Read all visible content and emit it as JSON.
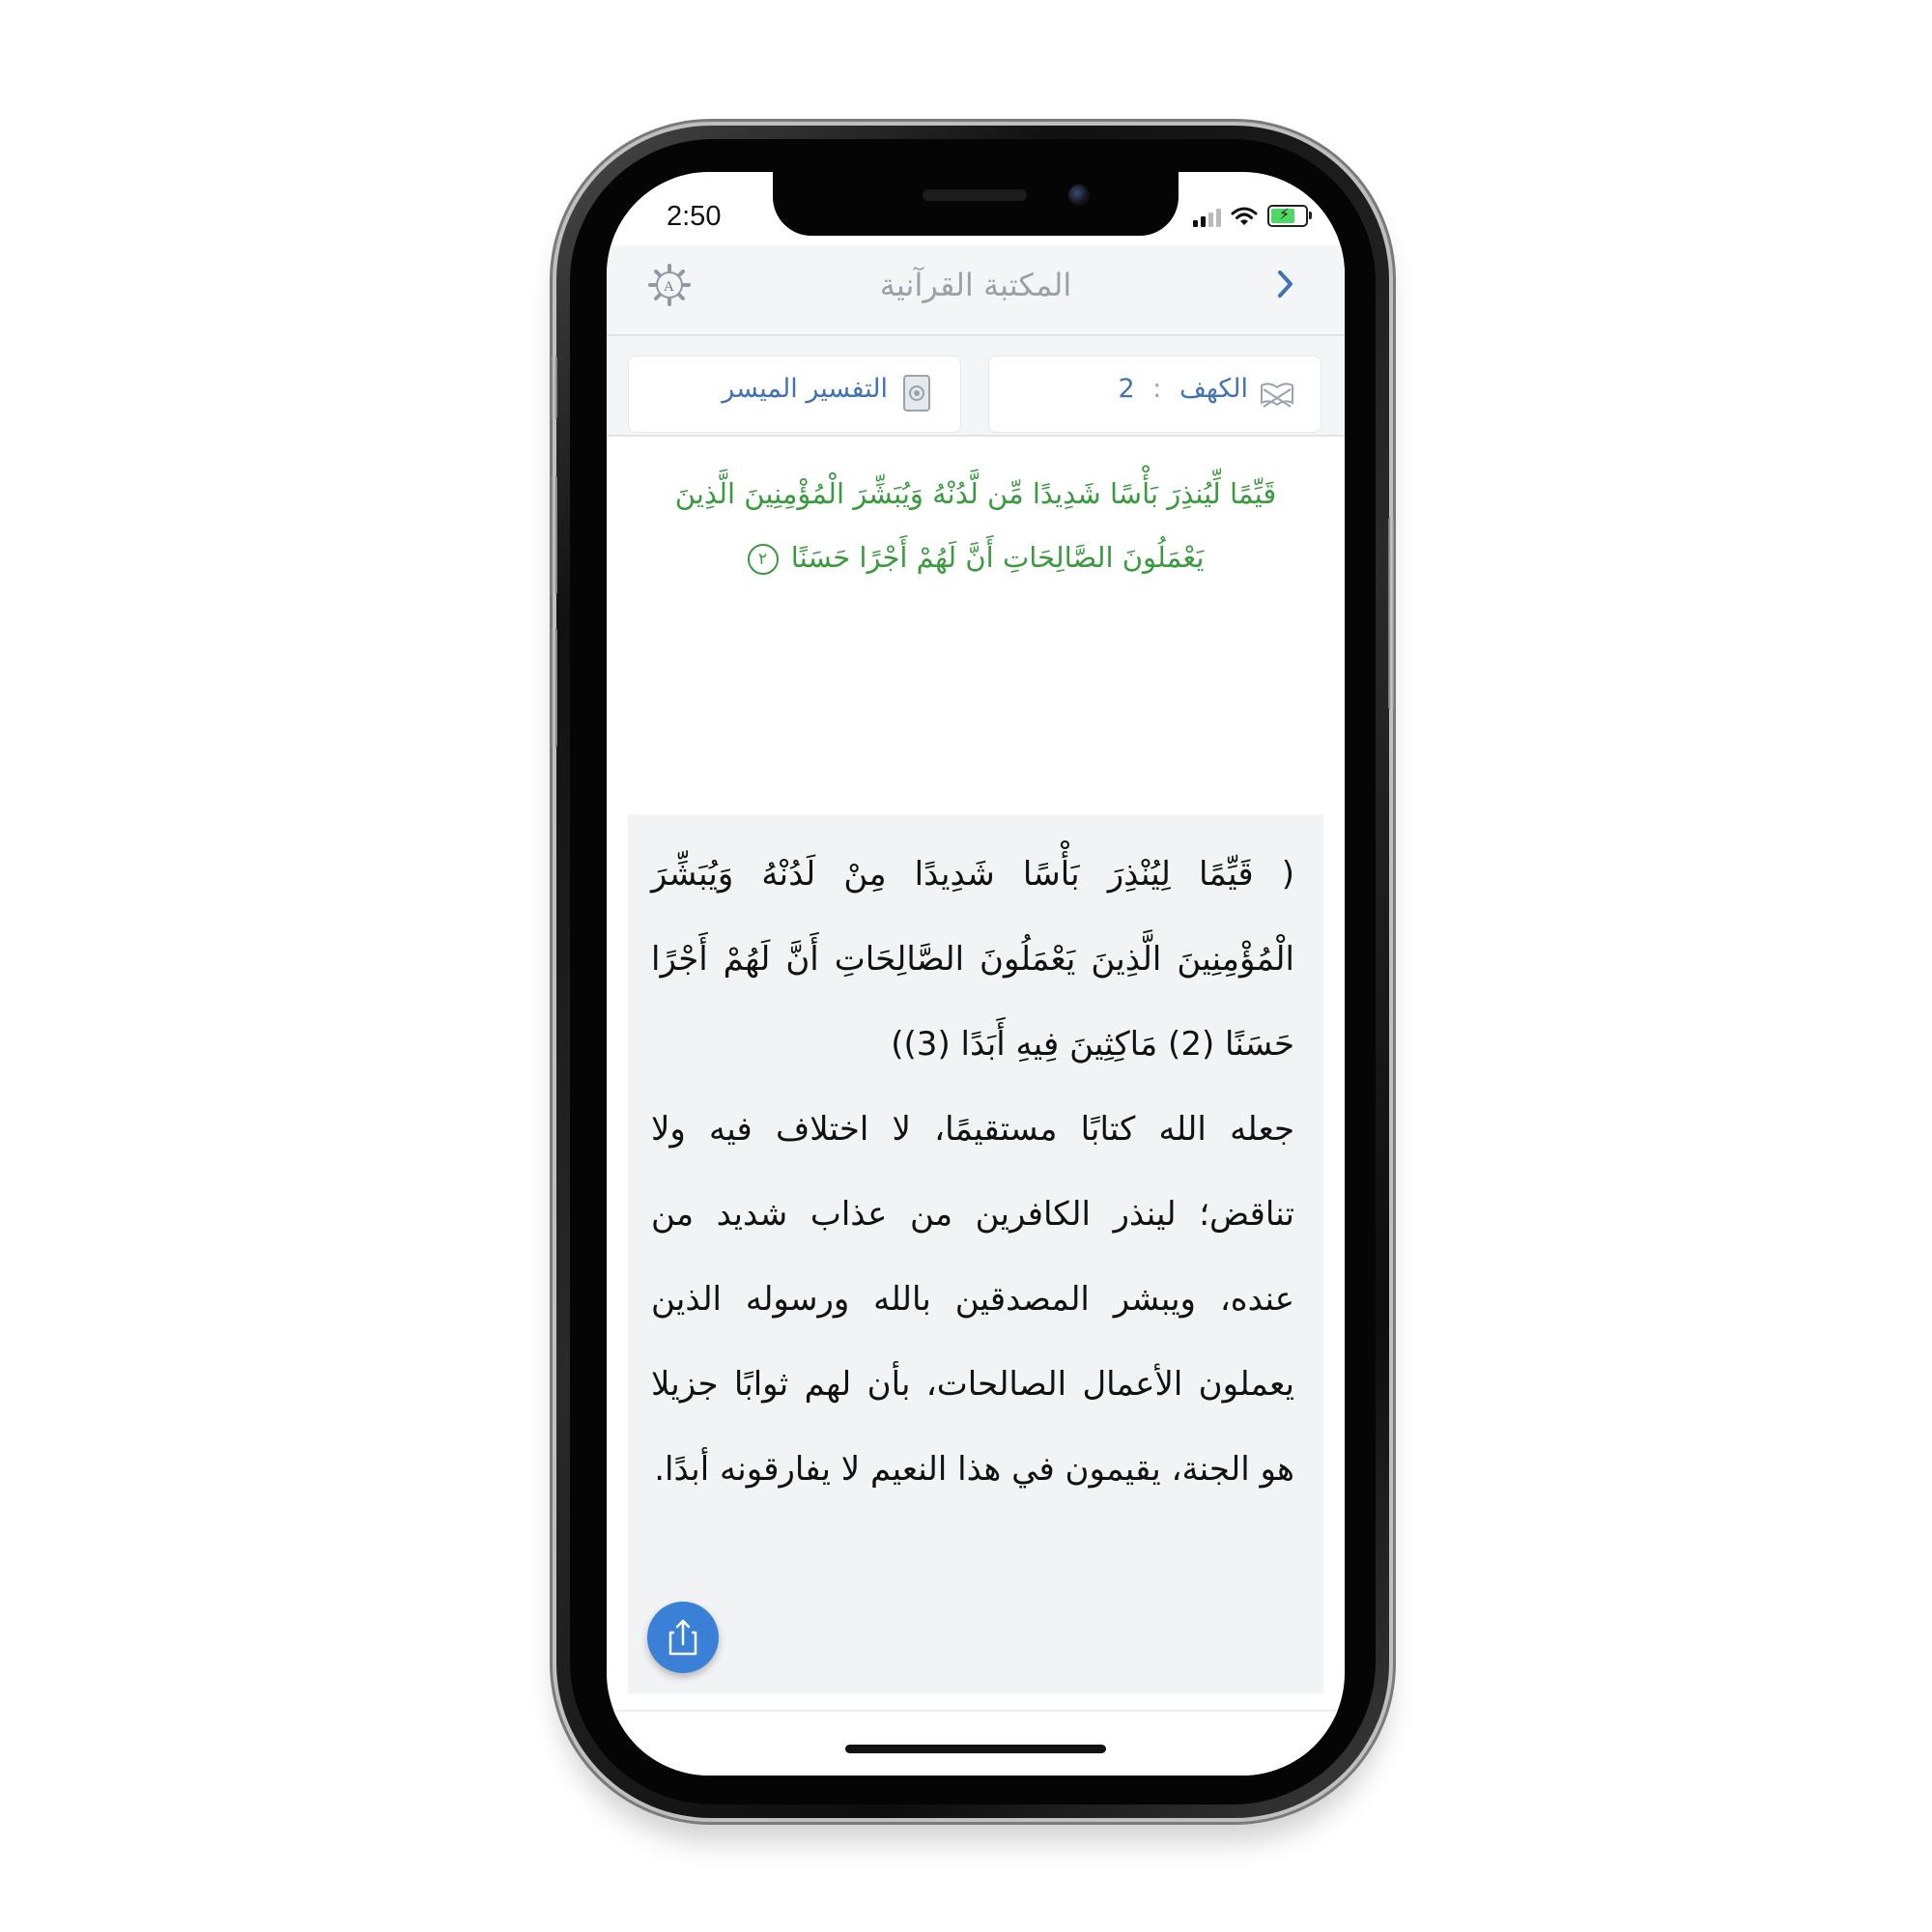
{
  "status_bar": {
    "time": "2:50"
  },
  "navbar": {
    "title": "المكتبة القرآنية"
  },
  "selectors": {
    "surah": {
      "name": "الكهف",
      "separator": ":",
      "ayah": "2"
    },
    "tafsir": {
      "label": "التفسير الميسر"
    }
  },
  "verse": {
    "text": "قَيِّمًا لِّيُنذِرَ بَأْسًا شَدِيدًا مِّن لَّدُنْهُ وَيُبَشِّرَ الْمُؤْمِنِينَ الَّذِينَ يَعْمَلُونَ الصَّالِحَاتِ أَنَّ لَهُمْ أَجْرًا حَسَنًا",
    "number": "٢"
  },
  "tafsir": {
    "quote": "( قَيِّمًا لِيُنْذِرَ بَأْسًا شَدِيدًا مِنْ لَدُنْهُ وَيُبَشِّرَ الْمُؤْمِنِينَ الَّذِينَ يَعْمَلُونَ الصَّالِحَاتِ أَنَّ لَهُمْ أَجْرًا حَسَنًا (2) مَاكِثِينَ فِيهِ أَبَدًا (3))",
    "body": "جعله الله كتابًا مستقيمًا، لا اختلاف فيه ولا تناقض؛ لينذر الكافرين من عذاب شديد من عنده، ويبشر المصدقين بالله ورسوله الذين يعملون الأعمال الصالحات، بأن لهم ثوابًا جزيلا هو الجنة، يقيمون في هذا النعيم لا يفارقونه أبدًا."
  },
  "colors": {
    "accent": "#3f73b4",
    "verse": "#3a9a3e",
    "share_button": "#3b80d7",
    "battery": "#4cd964"
  },
  "icons": {
    "back": "chevron-right-icon",
    "settings": "gear-icon",
    "surah": "open-book-icon",
    "tafsir": "quran-book-icon",
    "share": "share-icon"
  }
}
